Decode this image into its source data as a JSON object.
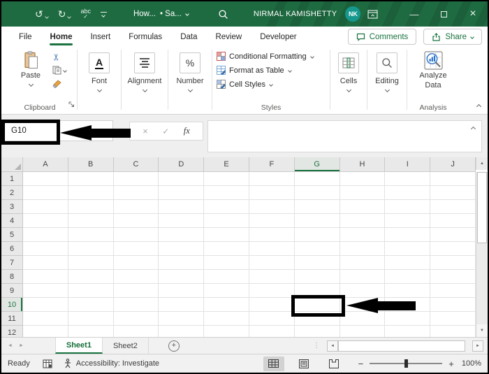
{
  "colors": {
    "titlebar_green": "#1e6b41",
    "accent_green": "#1a7340",
    "avatar_teal": "#16988f",
    "annotation_black": "#000000"
  },
  "titlebar": {
    "doc_title": "How...",
    "save_state": "• Sa...",
    "user": "NIRMAL KAMISHETTY",
    "avatar": "NK"
  },
  "tabs": {
    "items": [
      "File",
      "Home",
      "Insert",
      "Formulas",
      "Data",
      "Review",
      "Developer"
    ],
    "active": "Home",
    "comments": "Comments",
    "share": "Share"
  },
  "ribbon": {
    "paste": "Paste",
    "font": "Font",
    "alignment": "Alignment",
    "number": "Number",
    "conditional_formatting": "Conditional Formatting",
    "format_as_table": "Format as Table",
    "cell_styles": "Cell Styles",
    "cells": "Cells",
    "editing": "Editing",
    "analyze_data": "Analyze Data",
    "group_clipboard": "Clipboard",
    "group_styles": "Styles",
    "group_analysis": "Analysis"
  },
  "formula_bar": {
    "name_box": "G10",
    "fx": "fx"
  },
  "grid": {
    "columns": [
      "A",
      "B",
      "C",
      "D",
      "E",
      "F",
      "G",
      "H",
      "I",
      "J"
    ],
    "rows": [
      "1",
      "2",
      "3",
      "4",
      "5",
      "6",
      "7",
      "8",
      "9",
      "10",
      "11",
      "12"
    ],
    "selected_column": "G",
    "selected_row": "10",
    "selected_cell": "G10"
  },
  "sheetbar": {
    "sheets": [
      "Sheet1",
      "Sheet2"
    ],
    "active": "Sheet1"
  },
  "statusbar": {
    "mode": "Ready",
    "accessibility": "Accessibility: Investigate",
    "zoom": "100%"
  }
}
